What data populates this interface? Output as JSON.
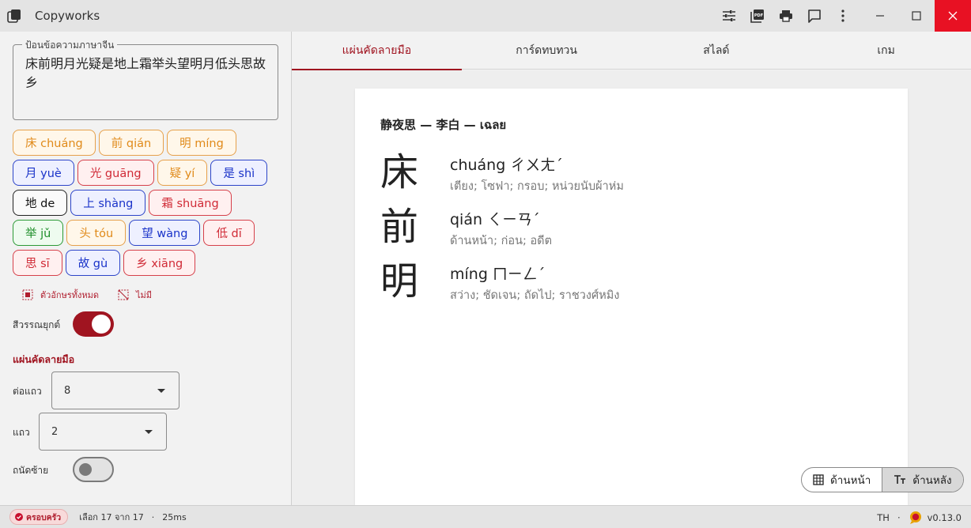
{
  "app": {
    "title": "Copyworks",
    "version": "v0.13.0",
    "lang": "TH"
  },
  "colors": {
    "accent": "#a01420",
    "close": "#e81123"
  },
  "input": {
    "legend": "ป้อนข้อความภาษาจีน",
    "value": "床前明月光疑是地上霜举头望明月低头思故乡"
  },
  "chips": [
    {
      "label": "床 chuáng",
      "color": "orange"
    },
    {
      "label": "前 qián",
      "color": "orange"
    },
    {
      "label": "明 míng",
      "color": "orange"
    },
    {
      "label": "月 yuè",
      "color": "blue"
    },
    {
      "label": "光 guāng",
      "color": "red"
    },
    {
      "label": "疑 yí",
      "color": "orange"
    },
    {
      "label": "是 shì",
      "color": "blue"
    },
    {
      "label": "地 de",
      "color": "black"
    },
    {
      "label": "上 shàng",
      "color": "blue"
    },
    {
      "label": "霜 shuāng",
      "color": "red"
    },
    {
      "label": "举 jǔ",
      "color": "green"
    },
    {
      "label": "头 tóu",
      "color": "orange"
    },
    {
      "label": "望 wàng",
      "color": "blue"
    },
    {
      "label": "低 dī",
      "color": "red"
    },
    {
      "label": "思 sī",
      "color": "red"
    },
    {
      "label": "故 gù",
      "color": "blue"
    },
    {
      "label": "乡 xiāng",
      "color": "red"
    }
  ],
  "selection": {
    "all": "ตัวอักษรทั้งหมด",
    "none": "ไม่มี"
  },
  "settings": {
    "tone_color_label": "สีวรรณยุกต์",
    "tone_color_on": true,
    "section_title": "แผ่นคัดลายมือ",
    "per_row_label": "ต่อแถว",
    "per_row_value": "8",
    "rows_label": "แถว",
    "rows_value": "2",
    "left_handed_label": "ถนัดซ้าย",
    "left_handed_on": false
  },
  "tabs": [
    "แผ่นคัดลายมือ",
    "การ์ดทบทวน",
    "สไลด์",
    "เกม"
  ],
  "active_tab": 0,
  "paper": {
    "title": "静夜思 — 李白 — เฉลย",
    "entries": [
      {
        "hanzi": "床",
        "pinyin": "chuáng ㄔㄨㄤˊ",
        "meaning": "เตียง; โซฟา; กรอบ; หน่วยนับผ้าห่ม"
      },
      {
        "hanzi": "前",
        "pinyin": "qián ㄑㄧㄢˊ",
        "meaning": "ด้านหน้า; ก่อน; อดีต"
      },
      {
        "hanzi": "明",
        "pinyin": "míng ㄇㄧㄥˊ",
        "meaning": "สว่าง; ชัดเจน; ถัดไป; ราชวงศ์หมิง"
      }
    ]
  },
  "view_toggle": {
    "front": "ด้านหน้า",
    "back": "ด้านหลัง",
    "active": "back"
  },
  "status": {
    "badge": "ครอบครัว",
    "selected": "เลือก 17 จาก 17",
    "timing": "25ms"
  }
}
